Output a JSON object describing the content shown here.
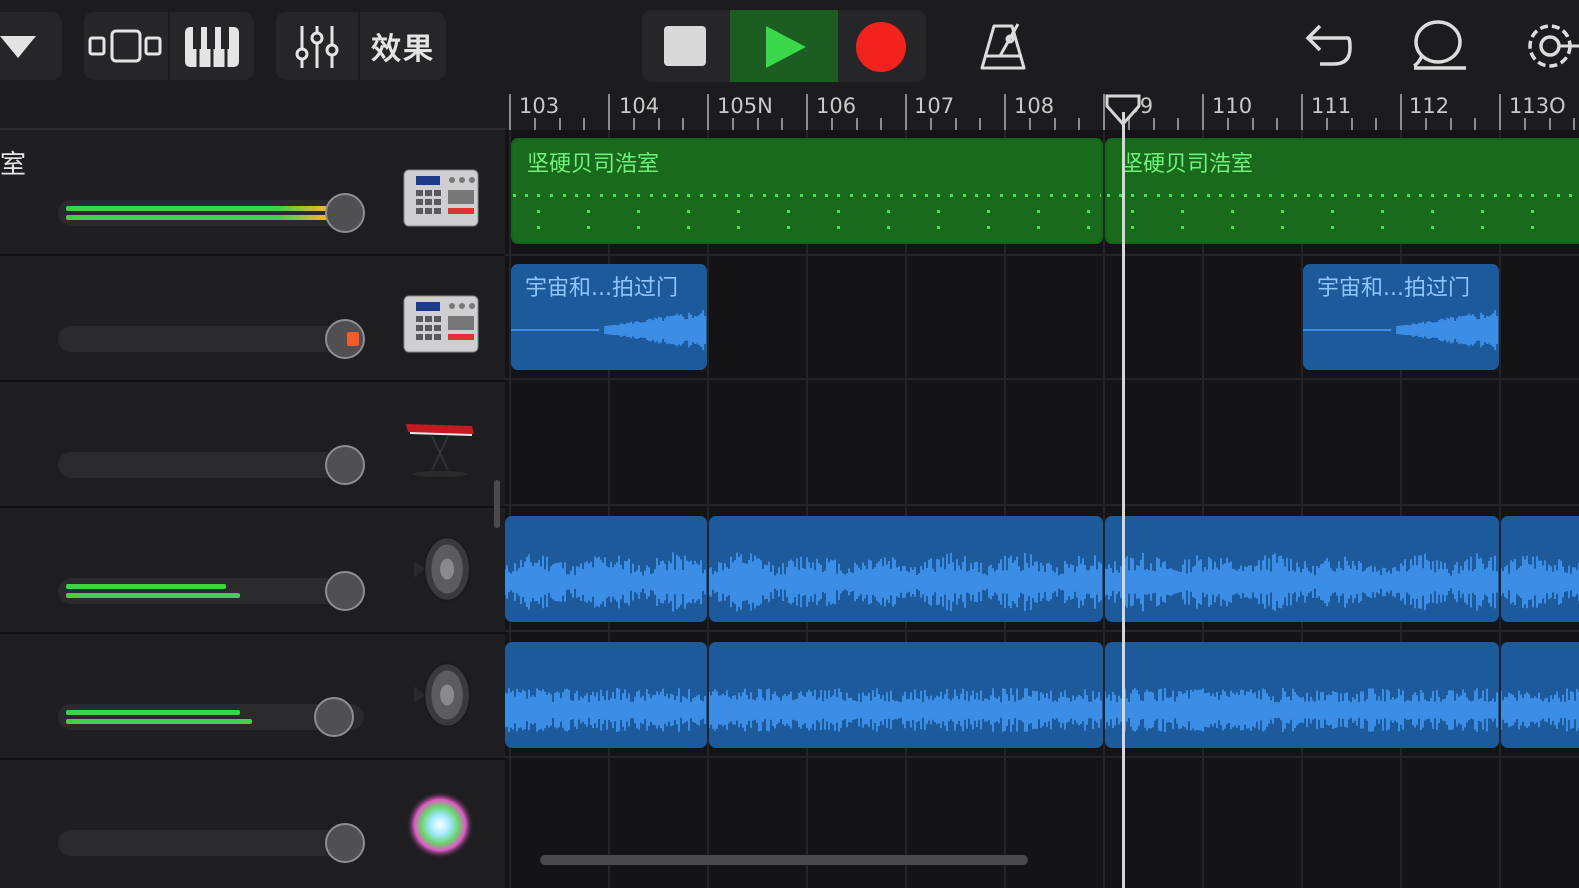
{
  "toolbar": {
    "effects_label": "效果",
    "icons": [
      "track-menu-triangle-icon",
      "tracks-view-icon",
      "keyboard-icon",
      "mixer-icon",
      "stop-icon",
      "play-icon",
      "record-icon",
      "metronome-icon",
      "undo-icon",
      "loop-browser-icon",
      "settings-icon"
    ],
    "colors": {
      "play": "#3ad84a",
      "record": "#f4221d",
      "play_bg": "#1c5d22"
    }
  },
  "ruler": {
    "bars": [
      "103",
      "104",
      "105N",
      "106",
      "107",
      "108",
      "109",
      "110",
      "111",
      "112",
      "113O"
    ]
  },
  "tracks": [
    {
      "name": "室",
      "instrument": "drum-machine-icon",
      "level": 0.92,
      "meters": [
        1.0,
        1.0
      ]
    },
    {
      "name": "",
      "instrument": "drum-machine-icon",
      "level": 0.92,
      "meters": [
        0,
        0
      ]
    },
    {
      "name": "",
      "instrument": "keyboard-synth-icon",
      "level": 0.92,
      "meters": [
        0,
        0
      ]
    },
    {
      "name": "",
      "instrument": "speaker-icon",
      "level": 0.92,
      "meters": [
        0.52,
        0.56
      ]
    },
    {
      "name": "",
      "instrument": "speaker-icon",
      "level": 0.88,
      "meters": [
        0.56,
        0.6
      ]
    },
    {
      "name": "",
      "instrument": "sampler-sparkle-icon",
      "level": 0.92,
      "meters": [
        0,
        0
      ]
    }
  ],
  "regions": {
    "drums_1": "坚硬贝司浩室",
    "drums_2": "坚硬贝司浩室",
    "sample_1": "宇宙和...拍过门",
    "sample_2": "宇宙和...拍过门"
  },
  "playhead_bar": 109.1,
  "colors": {
    "midi_region": "#1a6a1e",
    "audio_region": "#1d5a9c",
    "waveform": "#3b8de6",
    "meter_green": "#3ed24a",
    "meter_hot": "#f5b52a"
  }
}
